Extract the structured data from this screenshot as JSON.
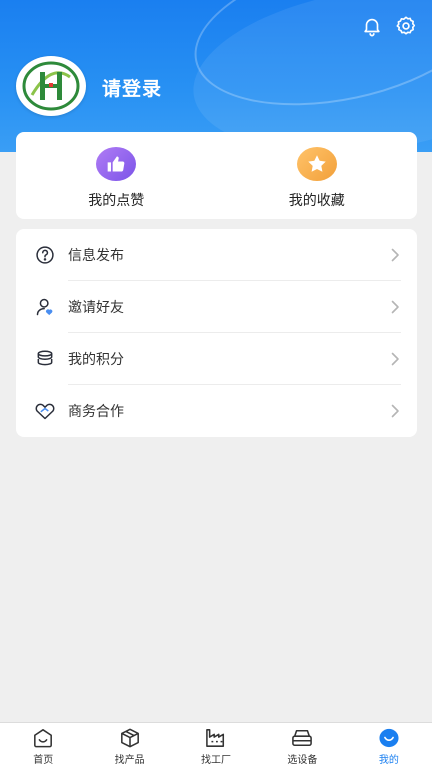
{
  "header": {
    "login_text": "请登录",
    "accent": "#1a7ff0"
  },
  "icons": {
    "notification": "bell-icon",
    "settings": "gear-icon",
    "avatar": "company-logo"
  },
  "favorites": {
    "items": [
      {
        "label": "我的点赞",
        "icon": "thumbs-up-icon",
        "color": "#8a62ee"
      },
      {
        "label": "我的收藏",
        "icon": "star-icon",
        "color": "#f5a93f"
      }
    ]
  },
  "menu": {
    "items": [
      {
        "label": "信息发布",
        "icon": "question-circle-icon"
      },
      {
        "label": "邀请好友",
        "icon": "user-heart-icon"
      },
      {
        "label": "我的积分",
        "icon": "coin-stack-icon"
      },
      {
        "label": "商务合作",
        "icon": "handshake-heart-icon"
      }
    ]
  },
  "tabbar": {
    "tabs": [
      {
        "label": "首页",
        "icon": "home-icon",
        "active": false
      },
      {
        "label": "找产品",
        "icon": "box-icon",
        "active": false
      },
      {
        "label": "找工厂",
        "icon": "factory-icon",
        "active": false
      },
      {
        "label": "选设备",
        "icon": "device-icon",
        "active": false
      },
      {
        "label": "我的",
        "icon": "profile-icon",
        "active": true
      }
    ]
  }
}
